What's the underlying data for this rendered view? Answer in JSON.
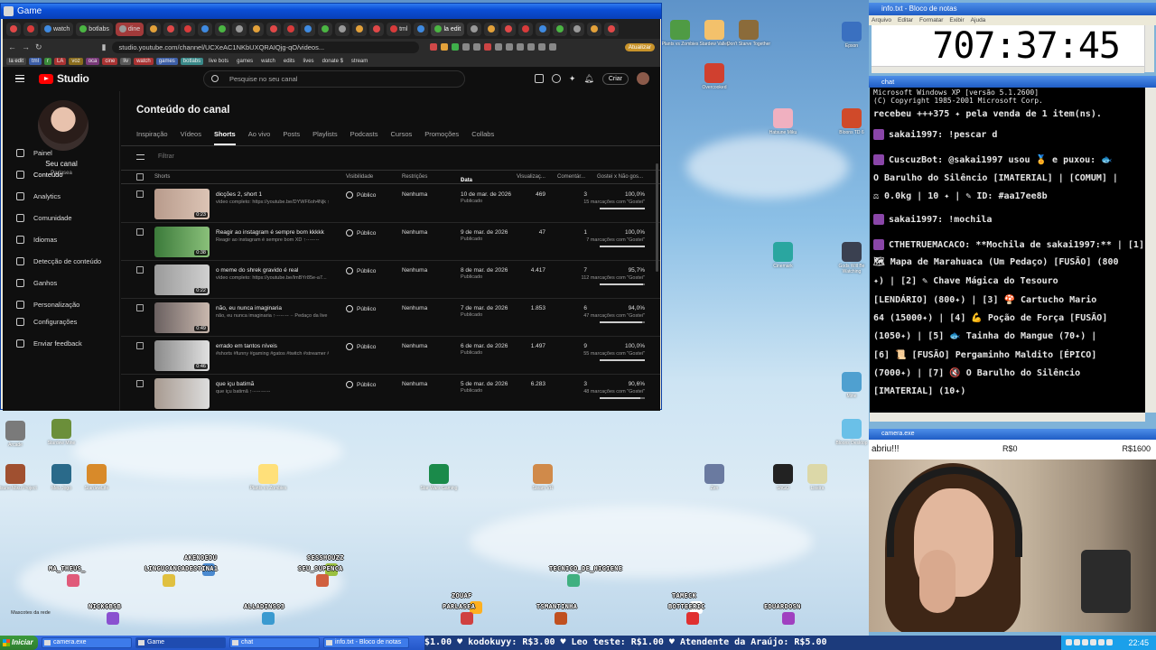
{
  "game_window": {
    "title": "Game",
    "tabs": [
      "",
      "",
      "watch",
      "botlabs",
      "dine",
      "",
      "",
      "",
      "",
      "",
      "",
      "",
      "",
      "",
      "",
      "",
      "",
      "",
      "",
      "tml",
      "",
      "la edit",
      "",
      "",
      "",
      "",
      "",
      "",
      "",
      "",
      ""
    ],
    "address": "studio.youtube.com/channel/UCXeAC1NKbUXQRAIQjg-qO/videos...",
    "update_label": "Atualizar",
    "bookmarks": [
      "la edit",
      "tml",
      "r",
      "LA",
      "voz",
      "oca",
      "cine",
      "liv",
      "watch",
      "games",
      "botlabs"
    ],
    "bookmark_folders": [
      "live bots",
      "games",
      "watch",
      "edits",
      "lives",
      "donate $",
      "stream"
    ]
  },
  "studio": {
    "brand": "Studio",
    "search_placeholder": "Pesquise no seu canal",
    "create_label": "Criar",
    "channel_name": "Seu canal",
    "channel_handle": "Parlasea",
    "nav": [
      {
        "label": "Painel",
        "icon": "dashboard-icon"
      },
      {
        "label": "Conteúdo",
        "icon": "content-icon",
        "active": true
      },
      {
        "label": "Analytics",
        "icon": "analytics-icon"
      },
      {
        "label": "Comunidade",
        "icon": "community-icon"
      },
      {
        "label": "Idiomas",
        "icon": "languages-icon"
      },
      {
        "label": "Detecção de conteúdo",
        "icon": "detection-icon"
      },
      {
        "label": "Ganhos",
        "icon": "earnings-icon"
      },
      {
        "label": "Personalização",
        "icon": "customization-icon"
      },
      {
        "label": "Configurações",
        "icon": "gear-icon"
      },
      {
        "label": "Enviar feedback",
        "icon": "feedback-icon"
      }
    ],
    "page_title": "Conteúdo do canal",
    "tabs": [
      "Inspiração",
      "Vídeos",
      "Shorts",
      "Ao vivo",
      "Posts",
      "Playlists",
      "Podcasts",
      "Cursos",
      "Promoções",
      "Collabs"
    ],
    "active_tab": "Shorts",
    "filter_label": "Filtrar",
    "columns": {
      "item": "Shorts",
      "visibility": "Visibilidade",
      "restrictions": "Restrições",
      "date": "Data",
      "views": "Visualizaç...",
      "comments": "Comentár...",
      "likes": "Gostei x Não gos..."
    },
    "rows": [
      {
        "title": "dicções 2, short 1",
        "desc": "vídeo completo: https://youtube.be/DYWF6oh4Njk ↑·-·--·--·--",
        "duration": "0:23",
        "visibility": "Público",
        "restriction": "Nenhuma",
        "date": "10 de mar. de 2026",
        "status": "Publicado",
        "views": "469",
        "comments": "3",
        "likes_pct": "100,0%",
        "likes_count": "15 marcações com \"Gostei\"",
        "like_ratio": 1.0
      },
      {
        "title": "Reagir ao instagram é sempre bom kkkkk",
        "desc": "Reagir ao instagram é sempre bom XD ↑·-·--·--",
        "duration": "0:38",
        "visibility": "Público",
        "restriction": "Nenhuma",
        "date": "9 de mar. de 2026",
        "status": "Publicado",
        "views": "47",
        "comments": "1",
        "likes_pct": "100,0%",
        "likes_count": "7 marcações com \"Gostei\"",
        "like_ratio": 1.0
      },
      {
        "title": "o meme do shrek gravido é real",
        "desc": "vídeo completo: https://youtube.be/ImBYr85e-a7...",
        "duration": "0:22",
        "visibility": "Público",
        "restriction": "Nenhuma",
        "date": "8 de mar. de 2026",
        "status": "Publicado",
        "views": "4.417",
        "comments": "7",
        "likes_pct": "95,7%",
        "likes_count": "112 marcações com \"Gostei\"",
        "like_ratio": 0.957
      },
      {
        "title": "não, eu nunca imaginaria",
        "desc": "não, eu nunca imaginaria ↑·-·--·-- ·· Pedaço da live da...",
        "duration": "0:49",
        "visibility": "Público",
        "restriction": "Nenhuma",
        "date": "7 de mar. de 2026",
        "status": "Publicado",
        "views": "1.853",
        "comments": "6",
        "likes_pct": "94,0%",
        "likes_count": "47 marcações com \"Gostei\"",
        "like_ratio": 0.94
      },
      {
        "title": "errado em tantos níveis",
        "desc": "#shorts #funny #gaming #gatos #twitch #streamer #memecats #processo",
        "duration": "0:46",
        "visibility": "Público",
        "restriction": "Nenhuma",
        "date": "6 de mar. de 2026",
        "status": "Publicado",
        "views": "1.497",
        "comments": "9",
        "likes_pct": "100,0%",
        "likes_count": "55 marcações com \"Gostei\"",
        "like_ratio": 1.0
      },
      {
        "title": "que içu batimã",
        "desc": "que içu batimã ↑·-·--·--·--",
        "duration": "",
        "visibility": "Público",
        "restriction": "Nenhuma",
        "date": "5 de mar. de 2026",
        "status": "Publicado",
        "views": "6.283",
        "comments": "3",
        "likes_pct": "90,6%",
        "likes_count": "48 marcações com \"Gostei\"",
        "like_ratio": 0.906
      }
    ]
  },
  "desktop_icons": [
    "Plants vs Zombies",
    "Stardew Valley",
    "Don't Starve Together",
    "Epson",
    "Overcooked",
    "Hatsune Miku",
    "Bloons TD 6",
    "Cinemark",
    "Gods Will Be Watching",
    "Mine",
    "Bloons Desktop",
    "Arcade",
    "Stardew Mine",
    "Hatsune Miku Project",
    "Meu Jogo",
    "StardewLife",
    "Plants vs Zombies",
    "Star Wars Gaming",
    "Steam VR",
    "Zen",
    "ShGO",
    "Lixeira"
  ],
  "notepad": {
    "title": "info.txt - Bloco de notas",
    "menu": [
      "Arquivo",
      "Editar",
      "Formatar",
      "Exibir",
      "Ajuda"
    ],
    "timer": "707:37:45"
  },
  "chat": {
    "title": "chat",
    "header_line1": "Microsoft Windows XP [versão 5.1.2600]",
    "header_line2": "(C) Copyright 1985-2001 Microsoft Corp.",
    "lines": [
      "recebeu +++375 ✦ pela venda de 1 item(ns).",
      "sakai1997: !pescar d",
      "CuscuzBot: @sakai1997 usou 🏅 e puxou: 🐟",
      "O Barulho do Silêncio [IMATERIAL] | [COMUM] |",
      "⚖ 0.0kg | 10 ✦ | ✎ ID: #aa17ee8b",
      "sakai1997: !mochila",
      "CTHETRUEMACACO: **Mochila de sakai1997:** | [1]",
      "🗺 Mapa de Marahuaca (Um Pedaço) [FUSÃO] (800",
      "✦) | [2] ✎ Chave Mágica do Tesouro",
      "[LENDÁRIO] (800✦) | [3] 🍄 Cartucho Mario",
      "64 (15000✦) | [4] 💪 Poção de Força [FUSÃO]",
      "(1050✦) | [5] 🐟 Tainha do Mangue (70✦) |",
      "[6] 📜 [FUSÃO] Pergaminho Maldito [ÉPICO]",
      "(7000✦) | [7] 🔇 O Barulho do Silêncio",
      "[IMATERIAL] (10✦)"
    ]
  },
  "camera": {
    "title": "camera.exe",
    "caption": "abriu!!!",
    "goal_current": "R$0",
    "goal_target": "R$1600"
  },
  "game_players": [
    "MA_THEUS_",
    "AKENOEDU",
    "LINGUCANCADESTINA1",
    "SESSHOUZZ",
    "SEU_SUPENCA",
    "TECNICO_DE_HIGIENE",
    "ZOUAF",
    "PARLASEA",
    "ALLADINSS3",
    "TSMANTINHA",
    "NICKGBSB",
    "TAMECK",
    "BOTTEERIC",
    "EDUARDOSN"
  ],
  "mascote_label": "Mascotes da rede",
  "taskbar": {
    "start": "Iniciar",
    "windows": [
      "camera.exe",
      "Game",
      "chat",
      "info.txt - Bloco de notas"
    ],
    "active": "Game",
    "ticker": "$1.00 ♥ kodokuyy: R$3.00 ♥ Leo teste: R$1.00 ♥ Atendente da Araújo: R$5.00",
    "clock": "22:45"
  },
  "colors": {
    "xp_title": "#0a4ed6",
    "youtube_red": "#ff0000",
    "studio_bg": "#0f0f0f",
    "chat_bg": "#000000",
    "taskbar": "#2457c9"
  }
}
